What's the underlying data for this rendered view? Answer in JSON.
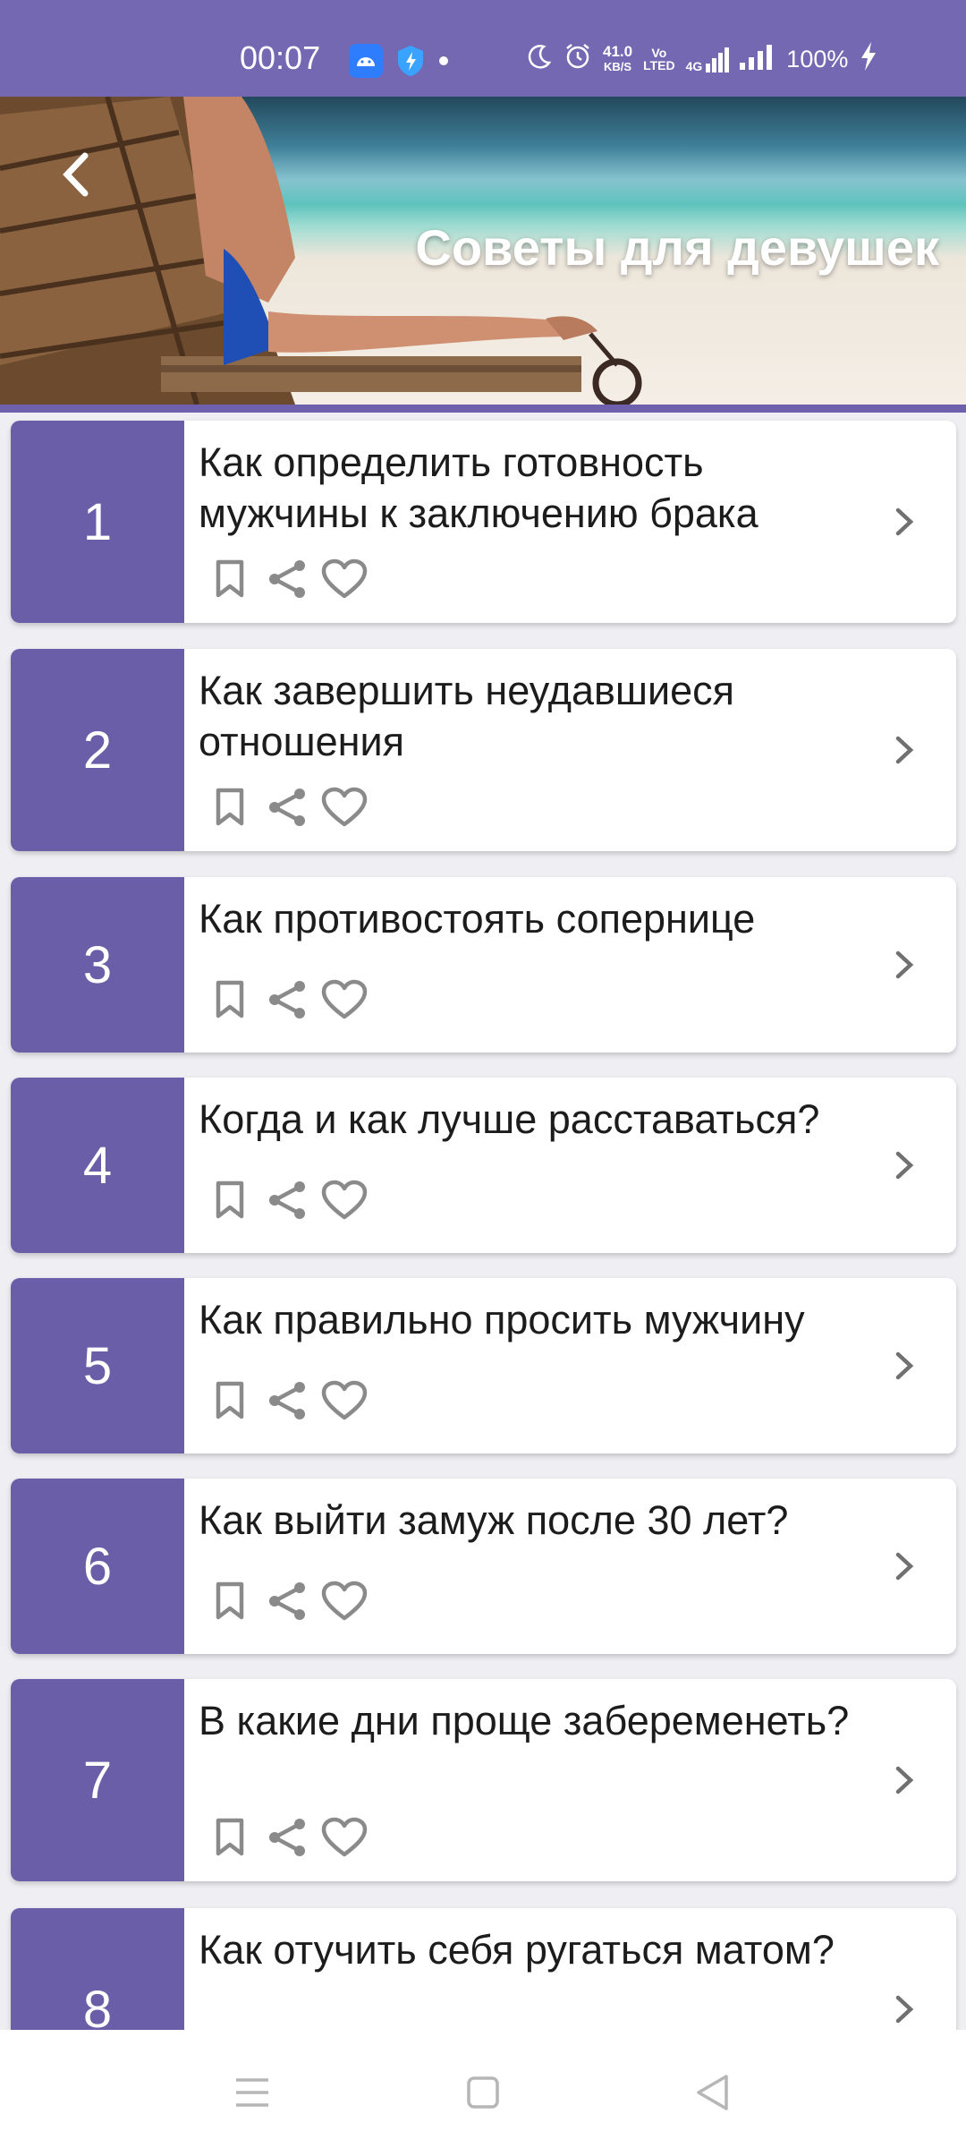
{
  "status_bar": {
    "time": "00:07",
    "speed_value": "41.0",
    "speed_unit": "KB/S",
    "volte_top": "Vo",
    "volte_bottom": "LTED",
    "network": "4G",
    "battery": "100%",
    "icons": [
      "android-icon",
      "shield-icon",
      "dot-icon",
      "moon-icon",
      "alarm-icon",
      "signal-icon",
      "signal-icon",
      "battery-charging-icon"
    ]
  },
  "header": {
    "title": "Советы для девушек",
    "back_icon": "chevron-left-icon"
  },
  "items": [
    {
      "number": "1",
      "title": "Как определить готовность мужчины к заключению брака"
    },
    {
      "number": "2",
      "title": "Как завершить неудавшиеся отношения"
    },
    {
      "number": "3",
      "title": "Как противостоять сопернице"
    },
    {
      "number": "4",
      "title": "Когда и как лучше расставаться?"
    },
    {
      "number": "5",
      "title": "Как правильно просить мужчину"
    },
    {
      "number": "6",
      "title": "Как выйти замуж после 30 лет?"
    },
    {
      "number": "7",
      "title": "В какие дни проще забеременеть?"
    },
    {
      "number": "8",
      "title": "Как отучить себя ругаться матом?"
    }
  ],
  "item_actions": [
    "bookmark-icon",
    "share-icon",
    "heart-icon"
  ],
  "nav_bar": {
    "buttons": [
      "menu-icon",
      "home-icon",
      "back-icon"
    ]
  },
  "colors": {
    "accent": "#6a5ea8",
    "status_bar": "#7568b3"
  }
}
